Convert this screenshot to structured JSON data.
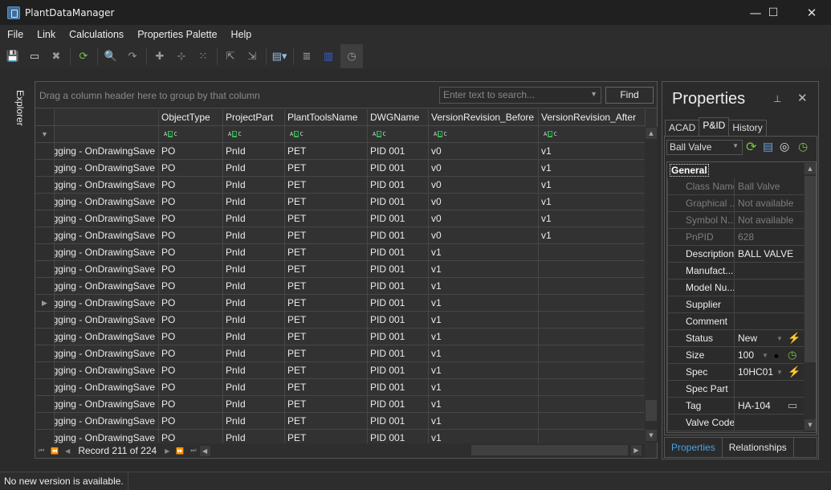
{
  "window": {
    "title": "PlantDataManager",
    "minimize": "—",
    "maximize": "☐",
    "close": "✕"
  },
  "menu": [
    "File",
    "Link",
    "Calculations",
    "Properties Palette",
    "Help"
  ],
  "toolbar": [
    {
      "name": "save-icon",
      "glyph": "💾"
    },
    {
      "name": "close-document-icon",
      "glyph": "▭"
    },
    {
      "name": "delete-icon",
      "glyph": "✖"
    },
    {
      "name": "refresh-icon",
      "glyph": "⟳"
    },
    {
      "name": "search-icon",
      "glyph": "🔍"
    },
    {
      "name": "replace-icon",
      "glyph": "↷"
    },
    {
      "name": "add-icon",
      "glyph": "✚"
    },
    {
      "name": "add-relation-icon",
      "glyph": "⊹"
    },
    {
      "name": "split-icon",
      "glyph": "⁙"
    },
    {
      "name": "export-icon",
      "glyph": "⇱"
    },
    {
      "name": "import-icon",
      "glyph": "⇲"
    },
    {
      "name": "table-view-icon",
      "glyph": "▤▾"
    },
    {
      "name": "rows-icon",
      "glyph": "≣"
    },
    {
      "name": "columns-icon",
      "glyph": "▥"
    },
    {
      "name": "history-icon",
      "glyph": "◷"
    }
  ],
  "explorer": {
    "label": "Explorer"
  },
  "grid": {
    "group_hint": "Drag a column header here to group by that column",
    "search_placeholder": "Enter text to search...",
    "find_label": "Find",
    "columns": [
      "",
      "ObjectType",
      "ProjectPart",
      "PlantToolsName",
      "DWGName",
      "VersionRevision_Before",
      "VersionRevision_After"
    ],
    "filter_glyph": "▼",
    "abc": [
      "A",
      "B",
      "C"
    ],
    "rows": [
      [
        "Logging - OnDrawingSave",
        "PO",
        "PnId",
        "PET",
        "PID 001",
        "v0",
        "v1"
      ],
      [
        "Logging - OnDrawingSave",
        "PO",
        "PnId",
        "PET",
        "PID 001",
        "v0",
        "v1"
      ],
      [
        "Logging - OnDrawingSave",
        "PO",
        "PnId",
        "PET",
        "PID 001",
        "v0",
        "v1"
      ],
      [
        "Logging - OnDrawingSave",
        "PO",
        "PnId",
        "PET",
        "PID 001",
        "v0",
        "v1"
      ],
      [
        "Logging - OnDrawingSave",
        "PO",
        "PnId",
        "PET",
        "PID 001",
        "v0",
        "v1"
      ],
      [
        "Logging - OnDrawingSave",
        "PO",
        "PnId",
        "PET",
        "PID 001",
        "v0",
        "v1"
      ],
      [
        "Logging - OnDrawingSave",
        "PO",
        "PnId",
        "PET",
        "PID 001",
        "v1",
        ""
      ],
      [
        "Logging - OnDrawingSave",
        "PO",
        "PnId",
        "PET",
        "PID 001",
        "v1",
        ""
      ],
      [
        "Logging - OnDrawingSave",
        "PO",
        "PnId",
        "PET",
        "PID 001",
        "v1",
        ""
      ],
      [
        "Logging - OnDrawingSave",
        "PO",
        "PnId",
        "PET",
        "PID 001",
        "v1",
        ""
      ],
      [
        "Logging - OnDrawingSave",
        "PO",
        "PnId",
        "PET",
        "PID 001",
        "v1",
        ""
      ],
      [
        "Logging - OnDrawingSave",
        "PO",
        "PnId",
        "PET",
        "PID 001",
        "v1",
        ""
      ],
      [
        "Logging - OnDrawingSave",
        "PO",
        "PnId",
        "PET",
        "PID 001",
        "v1",
        ""
      ],
      [
        "Logging - OnDrawingSave",
        "PO",
        "PnId",
        "PET",
        "PID 001",
        "v1",
        ""
      ],
      [
        "Logging - OnDrawingSave",
        "PO",
        "PnId",
        "PET",
        "PID 001",
        "v1",
        ""
      ],
      [
        "Logging - OnDrawingSave",
        "PO",
        "PnId",
        "PET",
        "PID 001",
        "v1",
        ""
      ],
      [
        "Logging - OnDrawingSave",
        "PO",
        "PnId",
        "PET",
        "PID 001",
        "v1",
        ""
      ],
      [
        "Logging - OnDrawingSave",
        "PO",
        "PnId",
        "PET",
        "PID 001",
        "v1",
        ""
      ]
    ],
    "current_row_index": 9,
    "current_row_glyph": "▶",
    "record_text": "Record 211 of 224",
    "nav": {
      "first": "⏮",
      "prev_page": "⏪",
      "prev": "◀",
      "next": "▶",
      "next_page": "⏩",
      "last": "⏭"
    }
  },
  "properties": {
    "title": "Properties",
    "pin": "⊥",
    "close": "✕",
    "tabs": [
      "ACAD",
      "P&ID",
      "History"
    ],
    "active_tab": "P&ID",
    "class_select": "Ball Valve",
    "category": "General",
    "rows": [
      {
        "name": "Class Name",
        "value": "Ball Valve",
        "readonly": true
      },
      {
        "name": "Graphical ...",
        "value": "Not available",
        "readonly": true
      },
      {
        "name": "Symbol N...",
        "value": "Not available",
        "readonly": true
      },
      {
        "name": "PnPID",
        "value": "628",
        "readonly": true
      },
      {
        "name": "Description",
        "value": "BALL VALVE",
        "readonly": false
      },
      {
        "name": "Manufact...",
        "value": "",
        "readonly": false
      },
      {
        "name": "Model Nu...",
        "value": "",
        "readonly": false
      },
      {
        "name": "Supplier",
        "value": "",
        "readonly": false
      },
      {
        "name": "Comment",
        "value": "",
        "readonly": false
      },
      {
        "name": "Status",
        "value": "New",
        "readonly": false,
        "dropdown": true,
        "icons": [
          "lightning-icon"
        ]
      },
      {
        "name": "Size",
        "value": "100",
        "readonly": false,
        "dropdown": true,
        "icons": [
          "person-icon",
          "history-icon"
        ]
      },
      {
        "name": "Spec",
        "value": "10HC01",
        "readonly": false,
        "dropdown": true,
        "icons": [
          "lightning-icon"
        ]
      },
      {
        "name": "Spec Part",
        "value": "",
        "readonly": false
      },
      {
        "name": "Tag",
        "value": "HA-104",
        "readonly": false,
        "icons": [
          "window-icon"
        ]
      },
      {
        "name": "Valve Code",
        "value": "",
        "readonly": false
      }
    ],
    "bottom_tabs": [
      "Properties",
      "Relationships"
    ],
    "active_bottom_tab": "Properties"
  },
  "status": {
    "text": "No new version is available."
  },
  "colors": {
    "accent_blue": "#4aa3e0",
    "green": "#7cc242",
    "lightning": "#f5c518",
    "filter_green": "#3cb35a"
  }
}
